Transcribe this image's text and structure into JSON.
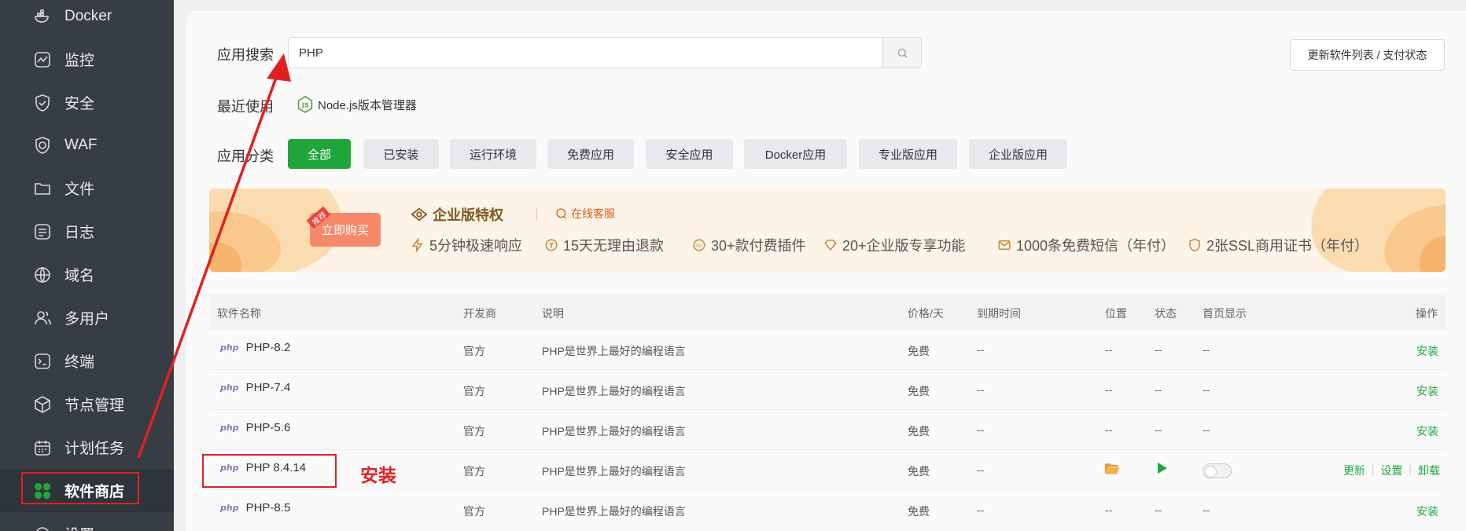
{
  "sidebar": {
    "items": [
      {
        "label": "Docker",
        "icon": "docker-icon"
      },
      {
        "label": "监控",
        "icon": "monitor-icon"
      },
      {
        "label": "安全",
        "icon": "shield-icon"
      },
      {
        "label": "WAF",
        "icon": "waf-icon"
      },
      {
        "label": "文件",
        "icon": "folder-icon"
      },
      {
        "label": "日志",
        "icon": "log-icon"
      },
      {
        "label": "域名",
        "icon": "globe-icon"
      },
      {
        "label": "多用户",
        "icon": "user-icon"
      },
      {
        "label": "终端",
        "icon": "terminal-icon"
      },
      {
        "label": "节点管理",
        "icon": "cube-icon"
      },
      {
        "label": "计划任务",
        "icon": "calendar-icon"
      },
      {
        "label": "软件商店",
        "icon": "apps-icon",
        "active": true
      },
      {
        "label": "设置",
        "icon": "settings-icon"
      }
    ]
  },
  "search": {
    "label": "应用搜索",
    "value": "PHP",
    "update_button": "更新软件列表 / 支付状态"
  },
  "recent": {
    "label": "最近使用",
    "items": [
      "Node.js版本管理器"
    ]
  },
  "categories": {
    "label": "应用分类",
    "tabs": [
      "全部",
      "已安装",
      "运行环境",
      "免费应用",
      "安全应用",
      "Docker应用",
      "专业版应用",
      "企业版应用"
    ],
    "active": "全部"
  },
  "banner": {
    "tag": "推荐",
    "buy_button": "立即购买",
    "title": "企业版特权",
    "online": "在线客服",
    "features": [
      "5分钟极速响应",
      "15天无理由退款",
      "30+款付费插件",
      "20+企业版专享功能",
      "1000条免费短信（年付）",
      "2张SSL商用证书（年付）"
    ]
  },
  "table": {
    "headers": [
      "软件名称",
      "开发商",
      "说明",
      "价格/天",
      "到期时间",
      "位置",
      "状态",
      "首页显示",
      "操作"
    ],
    "rows": [
      {
        "name": "PHP-8.2",
        "vendor": "官方",
        "desc": "PHP是世界上最好的编程语言",
        "price": "免费",
        "expire": "--",
        "location": "--",
        "status": "--",
        "home": "--",
        "action": "安装"
      },
      {
        "name": "PHP-7.4",
        "vendor": "官方",
        "desc": "PHP是世界上最好的编程语言",
        "price": "免费",
        "expire": "--",
        "location": "--",
        "status": "--",
        "home": "--",
        "action": "安装"
      },
      {
        "name": "PHP-5.6",
        "vendor": "官方",
        "desc": "PHP是世界上最好的编程语言",
        "price": "免费",
        "expire": "--",
        "location": "--",
        "status": "--",
        "home": "--",
        "action": "安装"
      },
      {
        "name": "PHP 8.4.14",
        "vendor": "官方",
        "desc": "PHP是世界上最好的编程语言",
        "price": "免费",
        "expire": "--",
        "actions": [
          "更新",
          "设置",
          "卸载"
        ]
      },
      {
        "name": "PHP-8.5",
        "vendor": "官方",
        "desc": "PHP是世界上最好的编程语言",
        "price": "免费",
        "expire": "--",
        "location": "--",
        "status": "--",
        "home": "--",
        "action": "安装"
      }
    ],
    "logo_text": "php"
  },
  "annotation": {
    "text": "安装",
    "color": "#e02020"
  },
  "colors": {
    "accent": "#20a53a",
    "sidebar": "#363d45",
    "annotation": "#e02020"
  }
}
